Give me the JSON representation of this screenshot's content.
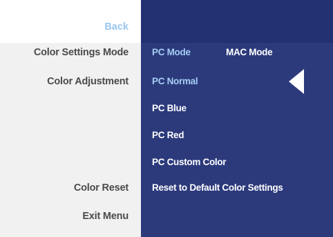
{
  "header": {
    "back_label": "Back"
  },
  "menu": {
    "items": [
      {
        "label": "Color Settings Mode"
      },
      {
        "label": "Color Adjustment"
      },
      {
        "label": "Color Reset"
      },
      {
        "label": "Exit Menu"
      }
    ]
  },
  "mode": {
    "options": [
      "PC Mode",
      "MAC Mode"
    ],
    "selected": "PC Mode"
  },
  "submenu": {
    "items": [
      {
        "label": "PC Normal"
      },
      {
        "label": "PC Blue"
      },
      {
        "label": "PC Red"
      },
      {
        "label": "PC Custom Color"
      },
      {
        "label": "Reset to Default Color Settings"
      }
    ],
    "selected": "PC Normal"
  },
  "colors": {
    "left_panel_bg": "#f1f1f1",
    "right_panel_bg": "#2c3a7c",
    "right_header_bg": "#233172",
    "highlight_text": "#a6cdf4",
    "back_text": "#9ac7ee",
    "menu_text": "#4a4a4a"
  },
  "icons": {
    "selection_pointer": "left-triangle-icon"
  }
}
